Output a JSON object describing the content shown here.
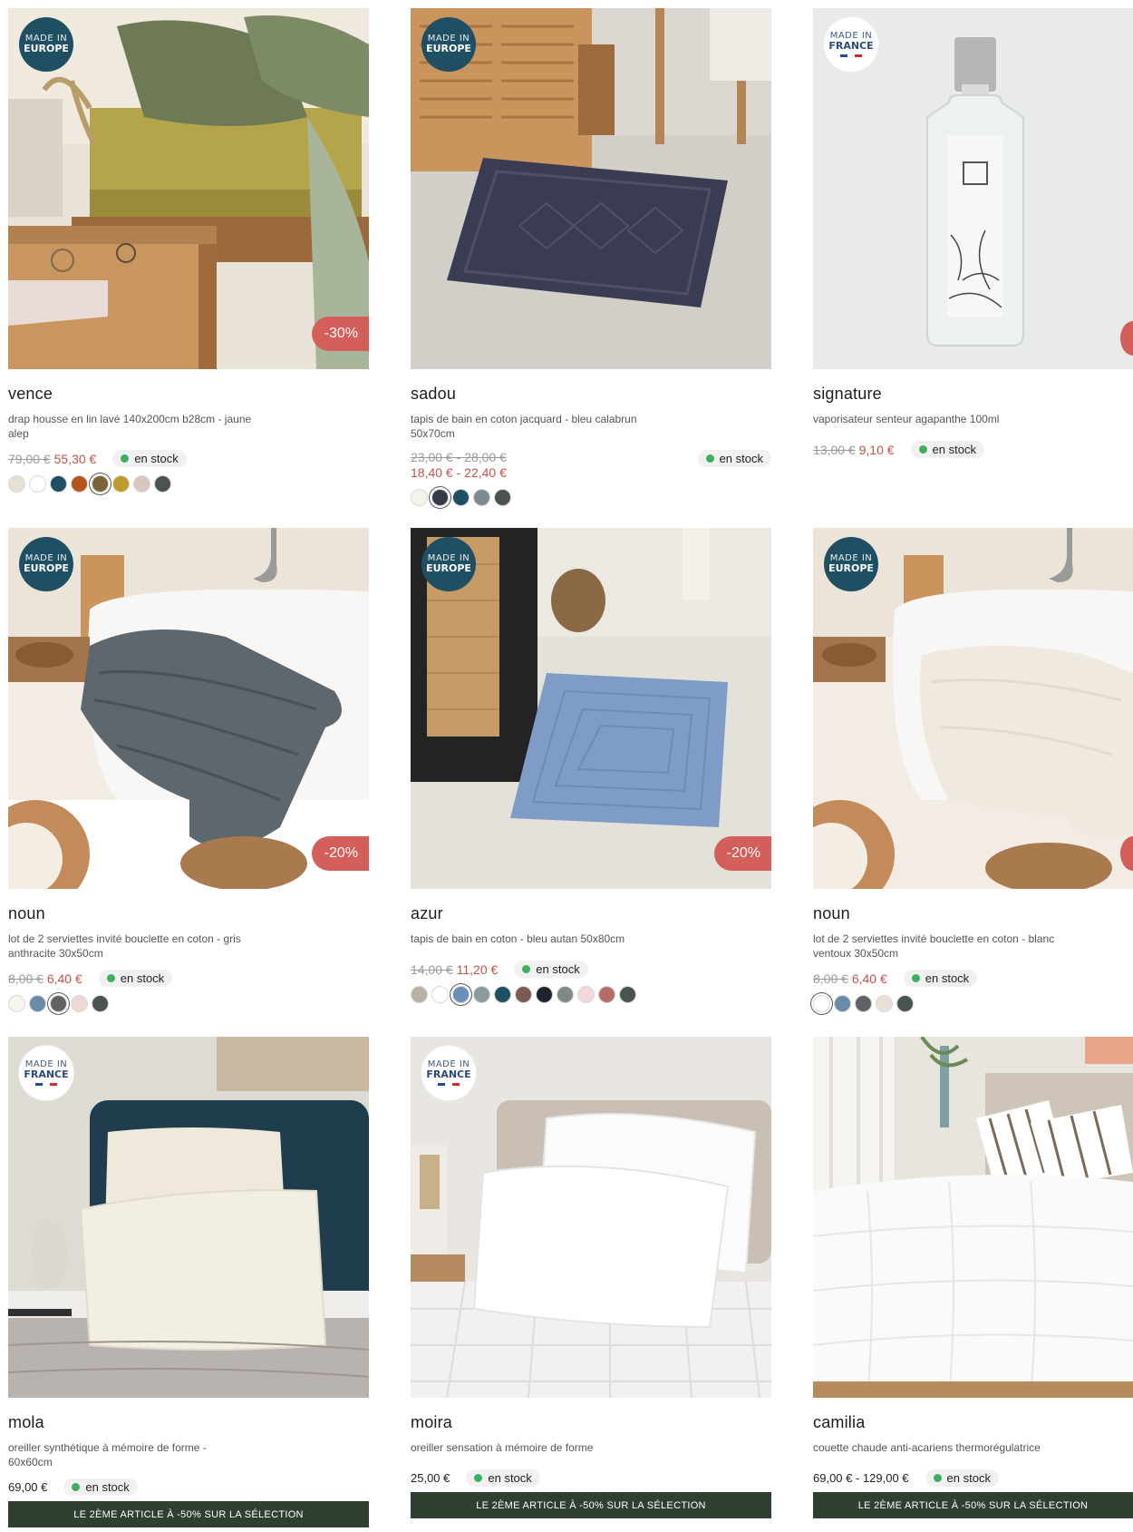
{
  "badges": {
    "europe": {
      "l1": "MADE IN",
      "l2": "EUROPE"
    },
    "france": {
      "l1": "MADE IN",
      "l2": "FRANCE"
    }
  },
  "colors": {
    "discount": "#d45f5a",
    "price_sale": "#c7524c",
    "stock_dot": "#3cb05c",
    "promo_bg": "#2f3f32",
    "europe_badge": "#1f4f63"
  },
  "products": [
    {
      "name": "vence",
      "description": "drap housse en lin lavé 140x200cm b28cm - jaune alep",
      "old_price": "79,00 €",
      "price": "55,30 €",
      "stock": "en stock",
      "discount": "-30%",
      "badge": "europe",
      "swatches": [
        "#e7dfd2",
        "#ffffff",
        "#1f4f63",
        "#b4551c",
        "#7a6438",
        "#c19b2a",
        "#d9c6c2",
        "#4b5350"
      ]
    },
    {
      "name": "sadou",
      "description": "tapis de bain en coton jacquard - bleu calabrun 50x70cm",
      "old_price": "23,00 € - 28,00 €",
      "price": "18,40 € - 22,40 €",
      "stock": "en stock",
      "badge": "europe",
      "swatches": [
        "#f5f2ea",
        "#343a48",
        "#1f4f63",
        "#7b8b8f",
        "#4b5350"
      ]
    },
    {
      "name": "signature",
      "description": "vaporisateur senteur agapanthe 100ml",
      "old_price": "13,00 €",
      "price": "9,10 €",
      "stock": "en stock",
      "badge": "france"
    },
    {
      "name": "noun",
      "description": "lot de 2 serviettes invité bouclette en coton - gris anthracite 30x50cm",
      "old_price": "8,00 €",
      "price": "6,40 €",
      "stock": "en stock",
      "discount": "-20%",
      "badge": "europe",
      "swatches": [
        "#f7f4ee",
        "#6a8aa8",
        "#5f6164",
        "#ecd9d4",
        "#4b5350"
      ]
    },
    {
      "name": "azur",
      "description": "tapis de bain en coton - bleu autan 50x80cm",
      "old_price": "14,00 €",
      "price": "11,20 €",
      "stock": "en stock",
      "discount": "-20%",
      "badge": "europe",
      "swatches": [
        "#b8b2a4",
        "#ffffff",
        "#6a8fb8",
        "#8a9a9e",
        "#1f4f63",
        "#7a5a52",
        "#1d2430",
        "#7e8a88",
        "#f2d8dc",
        "#b56c68",
        "#4b5350"
      ]
    },
    {
      "name": "noun",
      "description": "lot de 2 serviettes invité bouclette en coton - blanc ventoux 30x50cm",
      "old_price": "8,00 €",
      "price": "6,40 €",
      "stock": "en stock",
      "badge": "europe",
      "swatches": [
        "#ffffff",
        "#6a8aa8",
        "#5f6164",
        "#ebe0d6",
        "#4b5350"
      ]
    },
    {
      "name": "mola",
      "description": "oreiller synthétique à mémoire de forme - 60x60cm",
      "price": "69,00 €",
      "stock": "en stock",
      "badge": "france",
      "promo": "LE 2ÈME ARTICLE À -50% SUR LA SÉLECTION"
    },
    {
      "name": "moira",
      "description": "oreiller sensation à mémoire de forme",
      "price": "25,00 €",
      "stock": "en stock",
      "badge": "france",
      "promo": "LE 2ÈME ARTICLE À -50% SUR LA SÉLECTION"
    },
    {
      "name": "camilia",
      "description": "couette chaude anti-acariens thermorégulatrice",
      "price": "69,00 € - 129,00 €",
      "stock": "en stock",
      "promo": "LE 2ÈME ARTICLE À -50% SUR LA SÉLECTION"
    }
  ]
}
